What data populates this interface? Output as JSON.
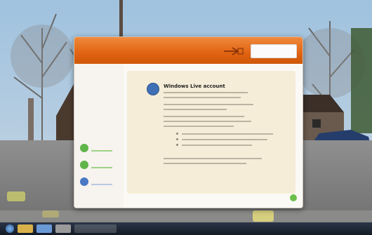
{
  "dialog": {
    "title": "Windows Live account",
    "header_field": "",
    "back_label": "",
    "next_label": "",
    "steps": [
      {
        "label": "",
        "color": "#5fb54a"
      },
      {
        "label": "",
        "color": "#5fb54a"
      },
      {
        "label": "",
        "color": "#4a78c4"
      }
    ]
  },
  "colors": {
    "header": "#e06312",
    "content_panel": "#f6edd8",
    "step_done": "#5fb54a",
    "step_current": "#4a78c4",
    "next_button": "#6abf4b"
  },
  "taskbar": {
    "items": [
      {
        "icon": "start-orb-icon"
      },
      {
        "icon": "explorer-icon"
      },
      {
        "icon": "browser-icon"
      },
      {
        "icon": "app-icon"
      }
    ],
    "window_button_label": ""
  }
}
